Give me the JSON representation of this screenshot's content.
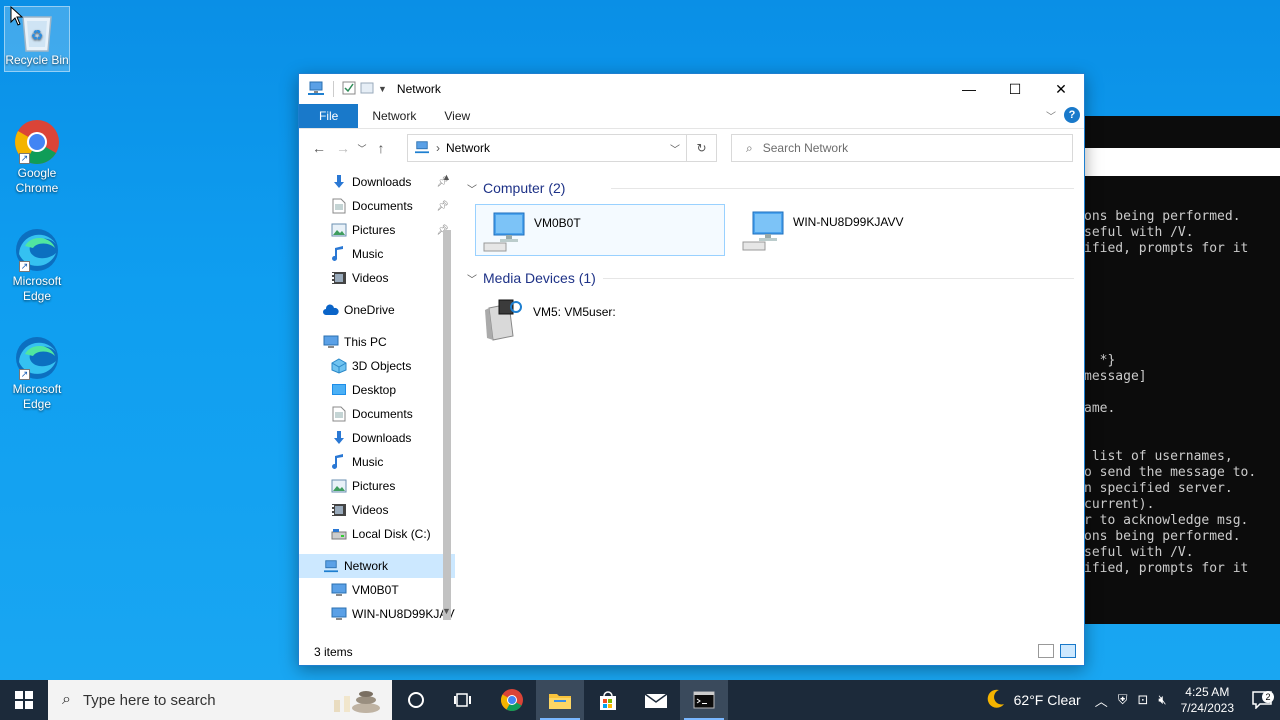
{
  "desktop": {
    "icons": [
      {
        "label": "Recycle Bin"
      },
      {
        "label": "Google Chrome"
      },
      {
        "label": "Microsoft Edge"
      },
      {
        "label": "Microsoft Edge"
      }
    ]
  },
  "console": {
    "lines": [
      "ons being performed.",
      "seful with /V.",
      "ified, prompts for it",
      "",
      "",
      "",
      "",
      "",
      "",
      "  *}",
      "message]",
      "",
      "ame.",
      "",
      "",
      " list of usernames,",
      "o send the message to.",
      "n specified server.",
      "current).",
      "r to acknowledge msg.",
      "ons being performed.",
      "seful with /V.",
      "ified, prompts for it"
    ]
  },
  "explorer": {
    "title": "Network",
    "ribbon_tabs": [
      "File",
      "Network",
      "View"
    ],
    "help": "?",
    "address": {
      "crumb": "Network"
    },
    "search": {
      "placeholder": "Search Network"
    },
    "nav": {
      "quick": [
        {
          "label": "Downloads",
          "icon": "download-arrow-icon",
          "pinned": true
        },
        {
          "label": "Documents",
          "icon": "document-icon",
          "pinned": true
        },
        {
          "label": "Pictures",
          "icon": "pictures-icon",
          "pinned": true
        },
        {
          "label": "Music",
          "icon": "music-note-icon",
          "pinned": false
        },
        {
          "label": "Videos",
          "icon": "video-icon",
          "pinned": false
        }
      ],
      "onedrive": "OneDrive",
      "thispc": "This PC",
      "pc_items": [
        {
          "label": "3D Objects",
          "icon": "cube-icon"
        },
        {
          "label": "Desktop",
          "icon": "desktop-folder-icon"
        },
        {
          "label": "Documents",
          "icon": "document-icon"
        },
        {
          "label": "Downloads",
          "icon": "download-arrow-icon"
        },
        {
          "label": "Music",
          "icon": "music-note-icon"
        },
        {
          "label": "Pictures",
          "icon": "pictures-icon"
        },
        {
          "label": "Videos",
          "icon": "video-icon"
        },
        {
          "label": "Local Disk (C:)",
          "icon": "disk-icon"
        }
      ],
      "network": "Network",
      "network_items": [
        "VM0B0T",
        "WIN-NU8D99KJAVV"
      ]
    },
    "groups": {
      "computer": {
        "header": "Computer (2)",
        "items": [
          "VM0B0T",
          "WIN-NU8D99KJAVV"
        ]
      },
      "media": {
        "header": "Media Devices (1)",
        "items": [
          "VM5: VM5user:"
        ]
      }
    },
    "status": "3 items"
  },
  "taskbar": {
    "search_placeholder": "Type here to search",
    "weather": "62°F  Clear",
    "time": "4:25 AM",
    "date": "7/24/2023",
    "notifications": "2"
  },
  "colors": {
    "accent": "#1979ca",
    "selection": "#cce8ff",
    "group_header": "#1e3287",
    "taskbar": "#1c2a3a"
  }
}
